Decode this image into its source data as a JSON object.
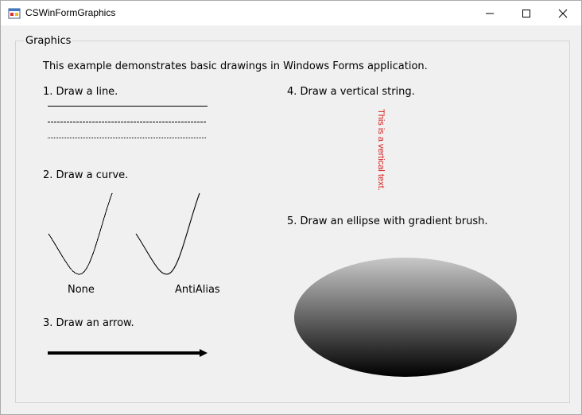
{
  "window": {
    "title": "CSWinFormGraphics",
    "icon": "winforms-app-icon",
    "controls": [
      "minimize-icon",
      "maximize-icon",
      "close-icon"
    ]
  },
  "group": {
    "title": "Graphics",
    "intro": "This example demonstrates basic drawings in Windows Forms application."
  },
  "sections": {
    "line": {
      "label": "1. Draw a line."
    },
    "curve": {
      "label": "2. Draw a curve.",
      "none_label": "None",
      "antialias_label": "AntiAlias"
    },
    "arrow": {
      "label": "3. Draw an arrow."
    },
    "vertical": {
      "label": "4. Draw a vertical string.",
      "text": "This is a vertical text.",
      "color": "#d61a1a"
    },
    "ellipse": {
      "label": "5. Draw an ellipse with gradient brush.",
      "gradient_top": "#c8c8c8",
      "gradient_bottom": "#000000"
    }
  }
}
